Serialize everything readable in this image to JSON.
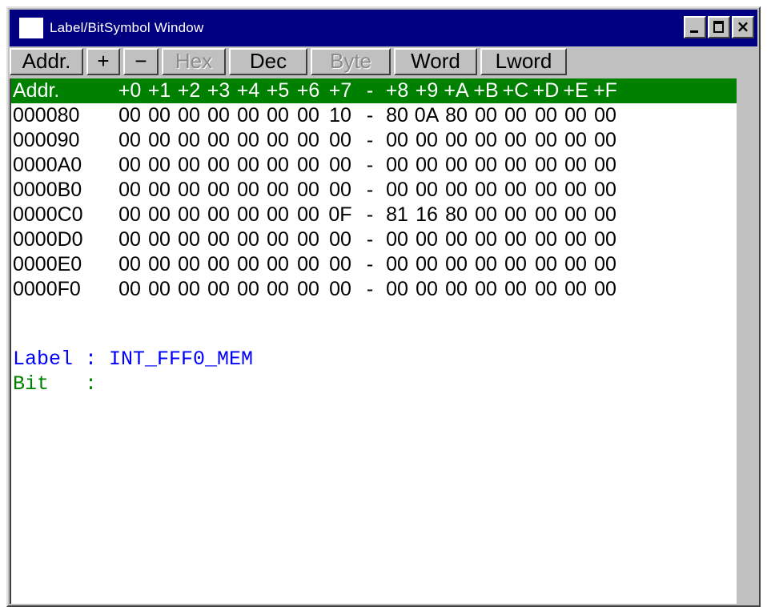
{
  "window": {
    "title": "Label/BitSymbol Window"
  },
  "toolbar": {
    "buttons": [
      {
        "label": "Addr.",
        "enabled": true
      },
      {
        "label": "+",
        "enabled": true
      },
      {
        "label": "−",
        "enabled": true
      },
      {
        "label": "Hex",
        "enabled": false
      },
      {
        "label": "Dec",
        "enabled": true
      },
      {
        "label": "Byte",
        "enabled": false
      },
      {
        "label": "Word",
        "enabled": true
      },
      {
        "label": "Lword",
        "enabled": true
      }
    ]
  },
  "dump": {
    "header": [
      "Addr.",
      "+0",
      "+1",
      "+2",
      "+3",
      "+4",
      "+5",
      "+6",
      "+7",
      "-",
      "+8",
      "+9",
      "+A",
      "+B",
      "+C",
      "+D",
      "+E",
      "+F"
    ],
    "rows": [
      [
        "000080",
        "00",
        "00",
        "00",
        "00",
        "00",
        "00",
        "00",
        "10",
        "-",
        "80",
        "0A",
        "80",
        "00",
        "00",
        "00",
        "00",
        "00"
      ],
      [
        "000090",
        "00",
        "00",
        "00",
        "00",
        "00",
        "00",
        "00",
        "00",
        "-",
        "00",
        "00",
        "00",
        "00",
        "00",
        "00",
        "00",
        "00"
      ],
      [
        "0000A0",
        "00",
        "00",
        "00",
        "00",
        "00",
        "00",
        "00",
        "00",
        "-",
        "00",
        "00",
        "00",
        "00",
        "00",
        "00",
        "00",
        "00"
      ],
      [
        "0000B0",
        "00",
        "00",
        "00",
        "00",
        "00",
        "00",
        "00",
        "00",
        "-",
        "00",
        "00",
        "00",
        "00",
        "00",
        "00",
        "00",
        "00"
      ],
      [
        "0000C0",
        "00",
        "00",
        "00",
        "00",
        "00",
        "00",
        "00",
        "0F",
        "-",
        "81",
        "16",
        "80",
        "00",
        "00",
        "00",
        "00",
        "00"
      ],
      [
        "0000D0",
        "00",
        "00",
        "00",
        "00",
        "00",
        "00",
        "00",
        "00",
        "-",
        "00",
        "00",
        "00",
        "00",
        "00",
        "00",
        "00",
        "00"
      ],
      [
        "0000E0",
        "00",
        "00",
        "00",
        "00",
        "00",
        "00",
        "00",
        "00",
        "-",
        "00",
        "00",
        "00",
        "00",
        "00",
        "00",
        "00",
        "00"
      ],
      [
        "0000F0",
        "00",
        "00",
        "00",
        "00",
        "00",
        "00",
        "00",
        "00",
        "-",
        "00",
        "00",
        "00",
        "00",
        "00",
        "00",
        "00",
        "00"
      ]
    ]
  },
  "info": {
    "label_line": "Label : INT_FFF0_MEM",
    "bit_line": "Bit   :"
  },
  "colors": {
    "titlebar": "#000080",
    "header": "#008000",
    "label_text": "#0000ff",
    "bit_text": "#008000"
  },
  "icons": {
    "window_icon": "window-icon",
    "minimize": "minimize-icon",
    "maximize": "maximize-icon",
    "close": "close-icon"
  }
}
